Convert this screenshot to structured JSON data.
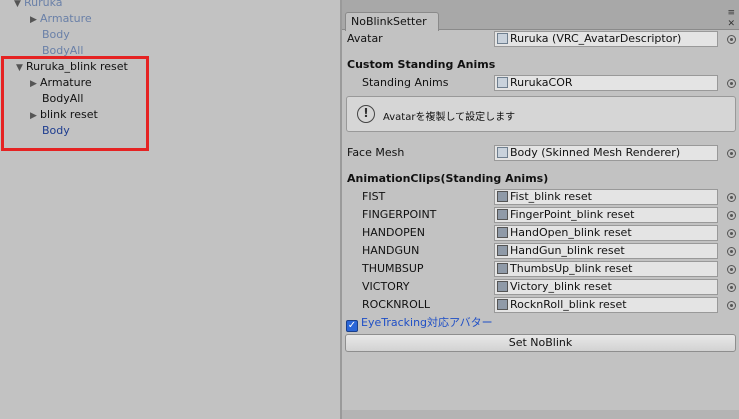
{
  "hierarchy": {
    "items": [
      {
        "label": "Ruruka",
        "expanded": true
      },
      {
        "label": "Armature"
      },
      {
        "label": "Body"
      },
      {
        "label": "BodyAll"
      },
      {
        "label": "Ruruka_blink reset",
        "expanded": true
      },
      {
        "label": "Armature"
      },
      {
        "label": "BodyAll"
      },
      {
        "label": "blink reset"
      },
      {
        "label": "Body"
      }
    ]
  },
  "window": {
    "tab_title": "NoBlinkSetter"
  },
  "inspector": {
    "avatar_label": "Avatar",
    "avatar_value": "Ruruka (VRC_AvatarDescriptor)",
    "custom_section": "Custom Standing Anims",
    "standing_label": "Standing Anims",
    "standing_value": "RurukaCOR",
    "help_text": "Avatarを複製して設定します",
    "face_mesh_label": "Face Mesh",
    "face_mesh_value": "Body (Skinned Mesh Renderer)",
    "clips_section": "AnimationClips(Standing Anims)",
    "clips": [
      {
        "label": "FIST",
        "value": "Fist_blink reset"
      },
      {
        "label": "FINGERPOINT",
        "value": "FingerPoint_blink reset"
      },
      {
        "label": "HANDOPEN",
        "value": "HandOpen_blink reset"
      },
      {
        "label": "HANDGUN",
        "value": "HandGun_blink reset"
      },
      {
        "label": "THUMBSUP",
        "value": "ThumbsUp_blink reset"
      },
      {
        "label": "VICTORY",
        "value": "Victory_blink reset"
      },
      {
        "label": "ROCKNROLL",
        "value": "RocknRoll_blink reset"
      }
    ],
    "eyetracking_label": "EyeTracking対応アバター",
    "eyetracking_checked": true,
    "set_button": "Set NoBlink"
  },
  "colors": {
    "highlight_box": "#e52222",
    "checkbox": "#2a66d8"
  }
}
